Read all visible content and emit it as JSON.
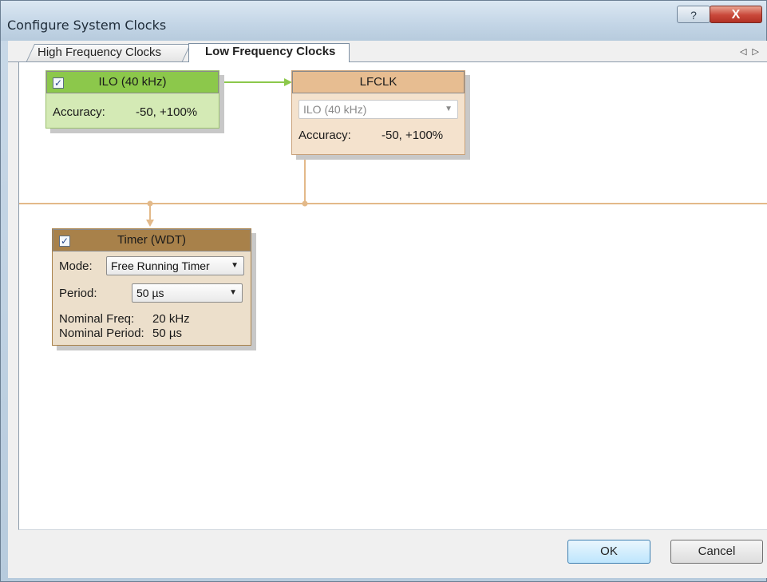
{
  "window": {
    "title": "Configure System Clocks",
    "help_icon": "?",
    "close_icon": "X"
  },
  "tabs": [
    {
      "label": "High Frequency Clocks",
      "active": false
    },
    {
      "label": "Low Frequency Clocks",
      "active": true
    }
  ],
  "tab_scroll": "◁ ▷",
  "ilo": {
    "label": "ILO (40 kHz)",
    "checked": true,
    "accuracy_label": "Accuracy:",
    "accuracy_value": "-50, +100%",
    "color": "#8cc84b"
  },
  "lfclk": {
    "label": "LFCLK",
    "source": "ILO (40 kHz)",
    "accuracy_label": "Accuracy:",
    "accuracy_value": "-50, +100%",
    "color": "#e7bd91"
  },
  "timer": {
    "label": "Timer (WDT)",
    "checked": true,
    "mode_label": "Mode:",
    "mode_value": "Free Running Timer",
    "period_label": "Period:",
    "period_value": "50 µs",
    "nominal_freq_label": "Nominal Freq:",
    "nominal_freq_value": "20 kHz",
    "nominal_period_label": "Nominal Period:",
    "nominal_period_value": "50 µs",
    "color": "#a8814a"
  },
  "colors": {
    "bus_line": "#e3b989",
    "ilo_arrow": "#8cc84b"
  },
  "buttons": {
    "ok": "OK",
    "cancel": "Cancel"
  }
}
